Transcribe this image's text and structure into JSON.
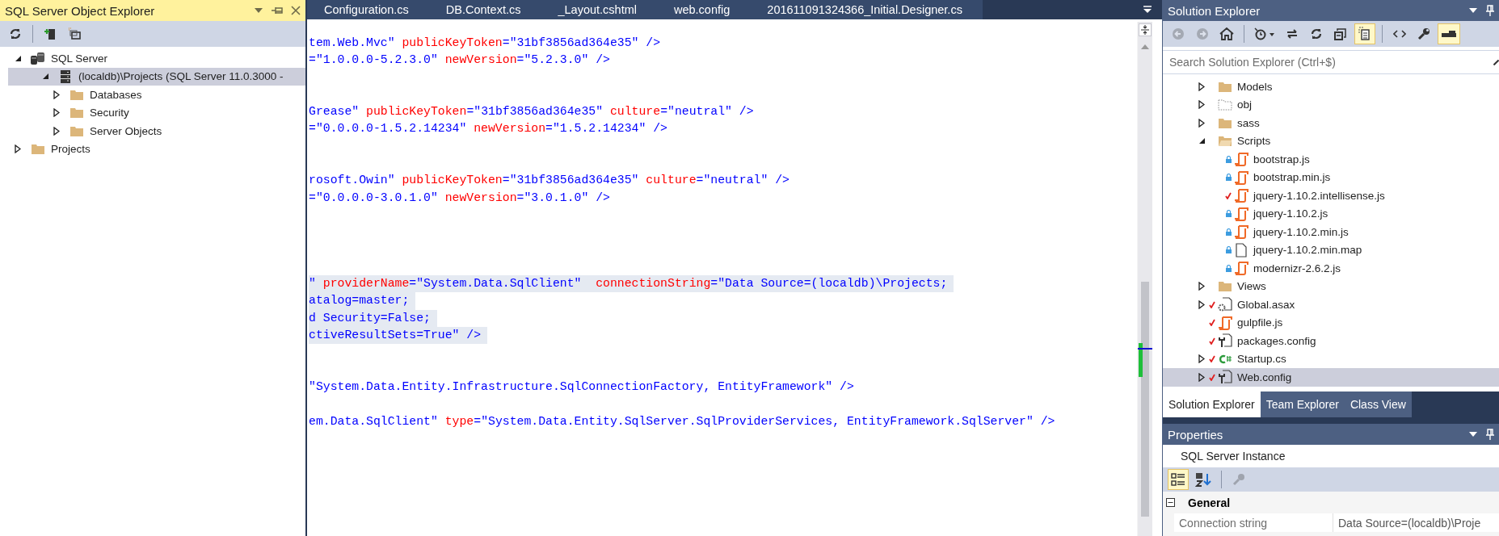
{
  "object_explorer": {
    "title": "SQL Server Object Explorer",
    "toolbar": [
      {
        "kind": "refresh",
        "disabled": false
      },
      {
        "kind": "add-server",
        "disabled": false
      },
      {
        "kind": "new-window",
        "disabled": false
      }
    ],
    "tree": [
      {
        "label": "SQL Server",
        "kind": "servers",
        "expanded": true,
        "selected": false,
        "children": [
          {
            "label": "(localdb)\\Projects (SQL Server 11.0.3000 -",
            "kind": "server",
            "expanded": true,
            "selected": true,
            "children": [
              {
                "label": "Databases",
                "kind": "folder",
                "expanded": false,
                "selected": false
              },
              {
                "label": "Security",
                "kind": "folder",
                "expanded": false,
                "selected": false
              },
              {
                "label": "Server Objects",
                "kind": "folder",
                "expanded": false,
                "selected": false
              }
            ]
          }
        ]
      },
      {
        "label": "Projects",
        "kind": "folder",
        "expanded": false,
        "selected": false
      }
    ]
  },
  "editor": {
    "tabs": [
      {
        "label": "Configuration.cs",
        "selected": false
      },
      {
        "label": "DB.Context.cs",
        "selected": false
      },
      {
        "label": "_Layout.cshtml",
        "selected": false
      },
      {
        "label": "web.config",
        "selected": false
      },
      {
        "label": "201611091324366_Initial.Designer.cs",
        "selected": false
      }
    ],
    "lines": [
      {
        "kind": "code",
        "selected": false,
        "parts": [
          {
            "kind": "value",
            "text": "tem.Web.Mvc\" "
          },
          {
            "kind": "attr",
            "text": "publicKeyToken"
          },
          {
            "kind": "value",
            "text": "=\"31bf3856ad364e35\" />"
          }
        ]
      },
      {
        "kind": "code",
        "selected": false,
        "parts": [
          {
            "kind": "value",
            "text": "=\"1.0.0.0-5.2.3.0\" "
          },
          {
            "kind": "attr",
            "text": "newVersion"
          },
          {
            "kind": "value",
            "text": "=\"5.2.3.0\" />"
          }
        ]
      },
      {
        "kind": "blank"
      },
      {
        "kind": "blank"
      },
      {
        "kind": "code",
        "selected": false,
        "parts": [
          {
            "kind": "value",
            "text": "Grease\" "
          },
          {
            "kind": "attr",
            "text": "publicKeyToken"
          },
          {
            "kind": "value",
            "text": "=\"31bf3856ad364e35\" "
          },
          {
            "kind": "attr",
            "text": "culture"
          },
          {
            "kind": "value",
            "text": "=\"neutral\" />"
          }
        ]
      },
      {
        "kind": "code",
        "selected": false,
        "parts": [
          {
            "kind": "value",
            "text": "=\"0.0.0.0-1.5.2.14234\" "
          },
          {
            "kind": "attr",
            "text": "newVersion"
          },
          {
            "kind": "value",
            "text": "=\"1.5.2.14234\" />"
          }
        ]
      },
      {
        "kind": "blank"
      },
      {
        "kind": "blank"
      },
      {
        "kind": "code",
        "selected": false,
        "parts": [
          {
            "kind": "value",
            "text": "rosoft.Owin\" "
          },
          {
            "kind": "attr",
            "text": "publicKeyToken"
          },
          {
            "kind": "value",
            "text": "=\"31bf3856ad364e35\" "
          },
          {
            "kind": "attr",
            "text": "culture"
          },
          {
            "kind": "value",
            "text": "=\"neutral\" />"
          }
        ]
      },
      {
        "kind": "code",
        "selected": false,
        "parts": [
          {
            "kind": "value",
            "text": "=\"0.0.0.0-3.0.1.0\" "
          },
          {
            "kind": "attr",
            "text": "newVersion"
          },
          {
            "kind": "value",
            "text": "=\"3.0.1.0\" />"
          }
        ]
      },
      {
        "kind": "blank"
      },
      {
        "kind": "blank"
      },
      {
        "kind": "blank"
      },
      {
        "kind": "blank"
      },
      {
        "kind": "code",
        "selected": true,
        "parts": [
          {
            "kind": "value",
            "text": "\" "
          },
          {
            "kind": "attr",
            "text": "providerName"
          },
          {
            "kind": "value",
            "text": "=\"System.Data.SqlClient\"  "
          },
          {
            "kind": "attr",
            "text": "connectionString"
          },
          {
            "kind": "value",
            "text": "=\"Data Source=(localdb)\\Projects;"
          }
        ]
      },
      {
        "kind": "code",
        "selected": true,
        "parts": [
          {
            "kind": "value",
            "text": "atalog=master;"
          }
        ]
      },
      {
        "kind": "code",
        "selected": true,
        "parts": [
          {
            "kind": "value",
            "text": "d Security=False;"
          }
        ]
      },
      {
        "kind": "code",
        "selected": true,
        "parts": [
          {
            "kind": "value",
            "text": "ctiveResultSets=True\" />"
          }
        ]
      },
      {
        "kind": "blank"
      },
      {
        "kind": "blank"
      },
      {
        "kind": "code",
        "selected": false,
        "parts": [
          {
            "kind": "value",
            "text": "\"System.Data.Entity.Infrastructure.SqlConnectionFactory, EntityFramework\" />"
          }
        ]
      },
      {
        "kind": "blank"
      },
      {
        "kind": "code",
        "selected": false,
        "parts": [
          {
            "kind": "value",
            "text": "em.Data.SqlClient\" "
          },
          {
            "kind": "attr",
            "text": "type"
          },
          {
            "kind": "value",
            "text": "=\"System.Data.Entity.SqlServer.SqlProviderServices, EntityFramework.SqlServer\" />"
          }
        ]
      }
    ]
  },
  "solution_explorer": {
    "title": "Solution Explorer",
    "toolbar": [
      {
        "kind": "back",
        "disabled": true,
        "on": false
      },
      {
        "kind": "forward",
        "disabled": true,
        "on": false
      },
      {
        "kind": "home",
        "disabled": false,
        "on": false
      },
      {
        "kind": "history",
        "disabled": false,
        "on": false
      },
      {
        "kind": "sync",
        "disabled": false,
        "on": false
      },
      {
        "kind": "refresh",
        "disabled": false,
        "on": false
      },
      {
        "kind": "collapse",
        "disabled": false,
        "on": false
      },
      {
        "kind": "show-all",
        "disabled": false,
        "on": true
      },
      {
        "kind": "code",
        "disabled": false,
        "on": false
      },
      {
        "kind": "properties",
        "disabled": false,
        "on": false
      },
      {
        "kind": "preview",
        "disabled": false,
        "on": true
      }
    ],
    "search": {
      "placeholder": "Search Solution Explorer (Ctrl+$)"
    },
    "tree": [
      {
        "label": "Models",
        "kind": "folder",
        "locked": false,
        "checked_out": false,
        "expanded": false,
        "selected": false
      },
      {
        "label": "obj",
        "kind": "hidden-folder",
        "locked": false,
        "checked_out": false,
        "expanded": false,
        "selected": false
      },
      {
        "label": "sass",
        "kind": "folder",
        "locked": false,
        "checked_out": false,
        "expanded": false,
        "selected": false
      },
      {
        "label": "Scripts",
        "kind": "open-folder",
        "locked": false,
        "checked_out": false,
        "expanded": true,
        "selected": false,
        "children": [
          {
            "label": "bootstrap.js",
            "kind": "script",
            "locked": true,
            "checked_out": false,
            "selected": false
          },
          {
            "label": "bootstrap.min.js",
            "kind": "script",
            "locked": true,
            "checked_out": false,
            "selected": false
          },
          {
            "label": "jquery-1.10.2.intellisense.js",
            "kind": "script",
            "locked": false,
            "checked_out": true,
            "selected": false
          },
          {
            "label": "jquery-1.10.2.js",
            "kind": "script",
            "locked": true,
            "checked_out": false,
            "selected": false
          },
          {
            "label": "jquery-1.10.2.min.js",
            "kind": "script",
            "locked": true,
            "checked_out": false,
            "selected": false
          },
          {
            "label": "jquery-1.10.2.min.map",
            "kind": "file",
            "locked": true,
            "checked_out": false,
            "selected": false
          },
          {
            "label": "modernizr-2.6.2.js",
            "kind": "script",
            "locked": true,
            "checked_out": false,
            "selected": false
          }
        ]
      },
      {
        "label": "Views",
        "kind": "folder",
        "locked": false,
        "checked_out": false,
        "expanded": false,
        "selected": false
      },
      {
        "label": "Global.asax",
        "kind": "asax",
        "locked": false,
        "checked_out": true,
        "expanded": false,
        "selected": false
      },
      {
        "label": "gulpfile.js",
        "kind": "script",
        "locked": false,
        "checked_out": true,
        "selected": false
      },
      {
        "label": "packages.config",
        "kind": "config",
        "locked": false,
        "checked_out": true,
        "selected": false
      },
      {
        "label": "Startup.cs",
        "kind": "csharp",
        "locked": false,
        "checked_out": true,
        "expanded": false,
        "selected": false
      },
      {
        "label": "Web.config",
        "kind": "config",
        "locked": false,
        "checked_out": true,
        "expanded": false,
        "selected": true
      }
    ],
    "tabs": [
      {
        "label": "Solution Explorer",
        "selected": true
      },
      {
        "label": "Team Explorer",
        "selected": false
      },
      {
        "label": "Class View",
        "selected": false
      }
    ]
  },
  "properties": {
    "title": "Properties",
    "object": "SQL Server Instance",
    "toolbar": [
      {
        "kind": "categorized",
        "disabled": false,
        "on": true
      },
      {
        "kind": "alphabetical",
        "disabled": false,
        "on": false
      },
      {
        "kind": "property-pages",
        "disabled": true,
        "on": false
      }
    ],
    "categories": [
      {
        "name": "General",
        "expanded": true,
        "rows": [
          {
            "name": "Connection string",
            "value": "Data Source=(localdb)\\Proje"
          }
        ]
      }
    ]
  }
}
